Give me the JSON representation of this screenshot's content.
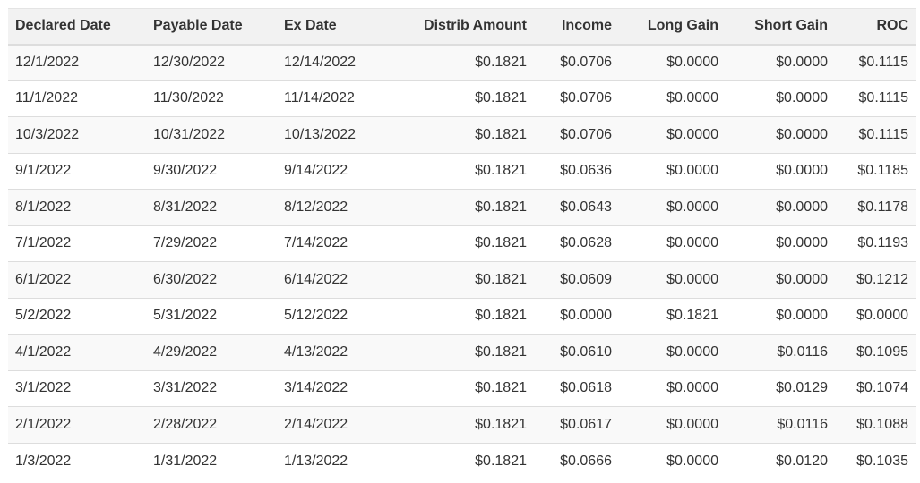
{
  "table": {
    "columns": [
      {
        "label": "Declared Date",
        "align": "left"
      },
      {
        "label": "Payable Date",
        "align": "left"
      },
      {
        "label": "Ex Date",
        "align": "left"
      },
      {
        "label": "Distrib Amount",
        "align": "right"
      },
      {
        "label": "Income",
        "align": "right"
      },
      {
        "label": "Long Gain",
        "align": "right"
      },
      {
        "label": "Short Gain",
        "align": "right"
      },
      {
        "label": "ROC",
        "align": "right"
      }
    ],
    "rows": [
      [
        "12/1/2022",
        "12/30/2022",
        "12/14/2022",
        "$0.1821",
        "$0.0706",
        "$0.0000",
        "$0.0000",
        "$0.1115"
      ],
      [
        "11/1/2022",
        "11/30/2022",
        "11/14/2022",
        "$0.1821",
        "$0.0706",
        "$0.0000",
        "$0.0000",
        "$0.1115"
      ],
      [
        "10/3/2022",
        "10/31/2022",
        "10/13/2022",
        "$0.1821",
        "$0.0706",
        "$0.0000",
        "$0.0000",
        "$0.1115"
      ],
      [
        "9/1/2022",
        "9/30/2022",
        "9/14/2022",
        "$0.1821",
        "$0.0636",
        "$0.0000",
        "$0.0000",
        "$0.1185"
      ],
      [
        "8/1/2022",
        "8/31/2022",
        "8/12/2022",
        "$0.1821",
        "$0.0643",
        "$0.0000",
        "$0.0000",
        "$0.1178"
      ],
      [
        "7/1/2022",
        "7/29/2022",
        "7/14/2022",
        "$0.1821",
        "$0.0628",
        "$0.0000",
        "$0.0000",
        "$0.1193"
      ],
      [
        "6/1/2022",
        "6/30/2022",
        "6/14/2022",
        "$0.1821",
        "$0.0609",
        "$0.0000",
        "$0.0000",
        "$0.1212"
      ],
      [
        "5/2/2022",
        "5/31/2022",
        "5/12/2022",
        "$0.1821",
        "$0.0000",
        "$0.1821",
        "$0.0000",
        "$0.0000"
      ],
      [
        "4/1/2022",
        "4/29/2022",
        "4/13/2022",
        "$0.1821",
        "$0.0610",
        "$0.0000",
        "$0.0116",
        "$0.1095"
      ],
      [
        "3/1/2022",
        "3/31/2022",
        "3/14/2022",
        "$0.1821",
        "$0.0618",
        "$0.0000",
        "$0.0129",
        "$0.1074"
      ],
      [
        "2/1/2022",
        "2/28/2022",
        "2/14/2022",
        "$0.1821",
        "$0.0617",
        "$0.0000",
        "$0.0116",
        "$0.1088"
      ],
      [
        "1/3/2022",
        "1/31/2022",
        "1/13/2022",
        "$0.1821",
        "$0.0666",
        "$0.0000",
        "$0.0120",
        "$0.1035"
      ]
    ]
  }
}
